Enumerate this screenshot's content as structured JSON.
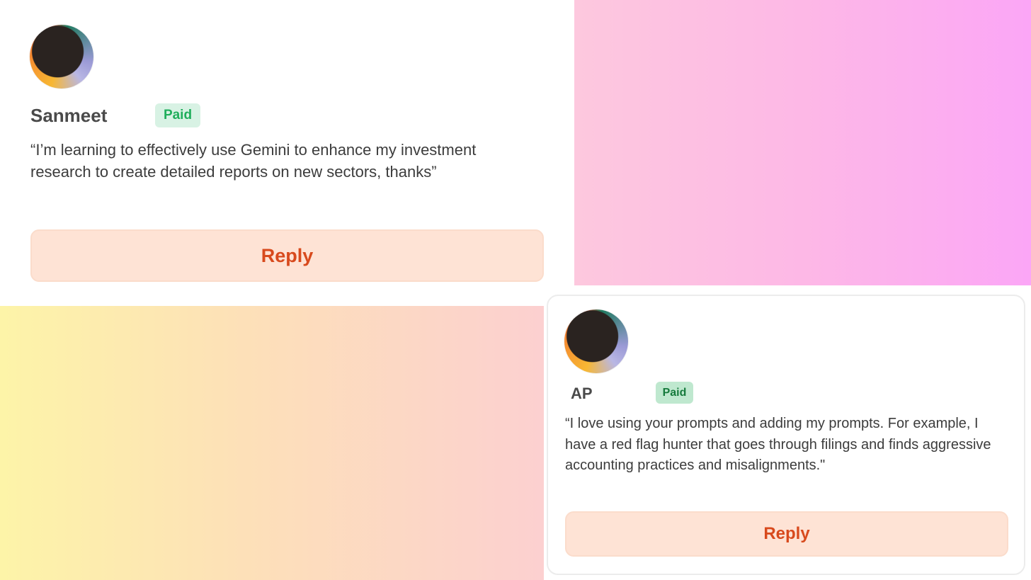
{
  "comments": [
    {
      "name": "Sanmeet",
      "badge": "Paid",
      "quote_line1": "“I’m learning to effectively use Gemini to enhance my investment",
      "quote_line2": "research to create detailed reports on new sectors, thanks”",
      "reply_label": "Reply"
    },
    {
      "name": "AP",
      "badge": "Paid",
      "quote_line1": "“I love using your prompts and adding my prompts. For example, I",
      "quote_line2": "have a red flag hunter that goes through filings and finds aggressive",
      "quote_line3": "accounting practices and misalignments.\"",
      "reply_label": "Reply"
    }
  ],
  "colors": {
    "reply_text": "#d84a1d",
    "reply_bg": "#fee3d5",
    "badge_text_1": "#1fae5b",
    "badge_bg_1": "#d8f2e4",
    "badge_text_2": "#157a3c",
    "badge_bg_2": "#bfe8cf"
  },
  "icons": {
    "avatar": "avatar-icon"
  }
}
